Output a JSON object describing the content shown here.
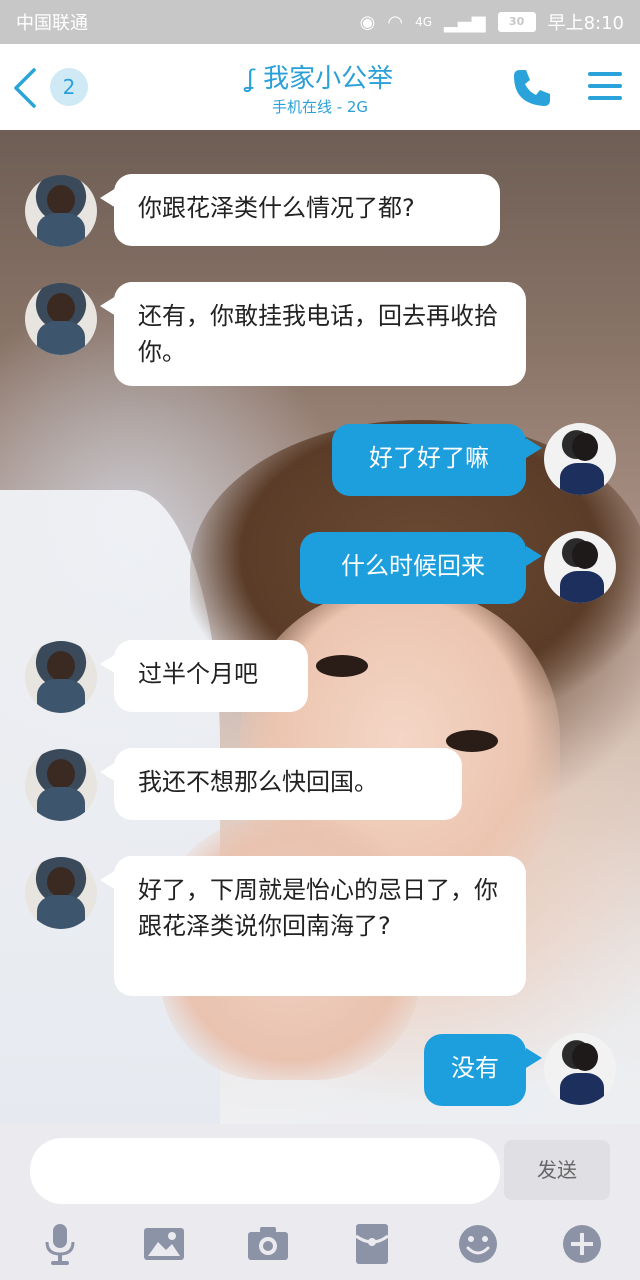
{
  "status_bar": {
    "carrier": "中国联通",
    "signal": "4G",
    "battery": "30",
    "time": "早上8:10"
  },
  "header": {
    "unread_count": "2",
    "contact_name": "我家小公举",
    "contact_status": "手机在线 - 2G"
  },
  "messages": [
    {
      "side": "left",
      "text": "你跟花泽类什么情况了都?"
    },
    {
      "side": "left",
      "text": "还有，你敢挂我电话，回去再收拾你。"
    },
    {
      "side": "right",
      "text": "好了好了嘛"
    },
    {
      "side": "right",
      "text": "什么时候回来"
    },
    {
      "side": "left",
      "text": "过半个月吧"
    },
    {
      "side": "left",
      "text": "我还不想那么快回国。"
    },
    {
      "side": "left",
      "text": "好了，下周就是怡心的忌日了，你跟花泽类说你回南海了?"
    },
    {
      "side": "right",
      "text": "没有"
    }
  ],
  "composer": {
    "input_value": "",
    "send_label": "发送"
  },
  "colors": {
    "accent": "#1e9fdd",
    "title": "#2aa0d8",
    "status_bar_bg": "#c7c7c7"
  },
  "toolbar_icons": [
    "microphone-icon",
    "image-icon",
    "camera-icon",
    "red-packet-icon",
    "emoji-icon",
    "plus-icon"
  ]
}
